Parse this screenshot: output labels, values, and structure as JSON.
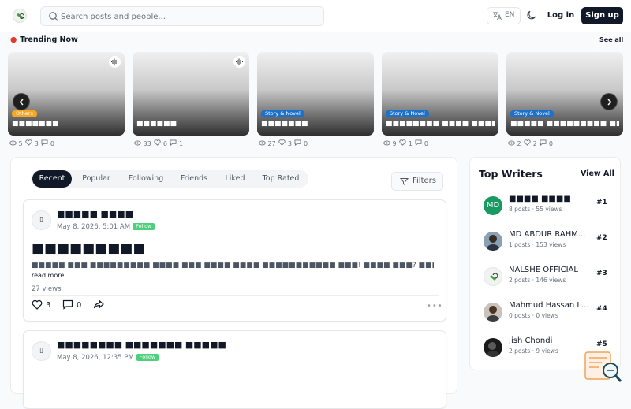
{
  "header": {
    "search_placeholder": "Search posts and people...",
    "lang_label": "EN",
    "login_label": "Log in",
    "signup_label": "Sign up"
  },
  "trending": {
    "title": "Trending Now",
    "see_all": "See all",
    "cards": [
      {
        "badge": "Others",
        "title": "■■■■■■■",
        "views": "5",
        "likes": "3",
        "comments": "0"
      },
      {
        "badge": "",
        "title": "■■■■■■",
        "views": "33",
        "likes": "6",
        "comments": "1"
      },
      {
        "badge": "Story & Novel",
        "title": "■■■■■■■",
        "views": "27",
        "likes": "3",
        "comments": "0"
      },
      {
        "badge": "Story & Novel",
        "title": "■■■■■■■■ ■■■■ ■■■■■■, ■…",
        "views": "9",
        "likes": "1",
        "comments": "0"
      },
      {
        "badge": "Story & Novel",
        "title": "■■■■■ ■■■■■■■■■ ■■■■■■",
        "views": "2",
        "likes": "2",
        "comments": "0"
      }
    ]
  },
  "feed": {
    "tabs": [
      "Recent",
      "Popular",
      "Following",
      "Friends",
      "Liked",
      "Top Rated"
    ],
    "filters_label": "Filters",
    "posts": [
      {
        "author": "■■■■■ ■■■■",
        "date": "May 8, 2026, 5:01 AM",
        "follow": "Follow",
        "title": "■■■■■■■■■",
        "excerpt": "■■■■■ ■■■ ■■■■■■■■■ ■■■■ ■■■ ■■■■ ■■■■ ■■■■■■■■■■■ ■■■! ■■■■ ■■■? ■■■■■■ ■■■■ ■■■■ ■■■ ■■■■ ■■■■■ ■■■■■ ■■",
        "read_more": "read more...",
        "views": "27 views",
        "likes": "3",
        "comments": "0"
      },
      {
        "author": "■■■■■■■■ ■■■■■■■ ■■■■■",
        "date": "May 8, 2026, 12:35 PM",
        "follow": "Follow"
      }
    ]
  },
  "writers": {
    "title": "Top Writers",
    "view_all": "View All",
    "list": [
      {
        "initials": "MD",
        "name": "■■■■ ■■■■",
        "meta": "8 posts · 55 views",
        "rank": "#1"
      },
      {
        "initials": "",
        "name": "MD ABDUR RAHM...",
        "meta": "1 posts · 153 views",
        "rank": "#2"
      },
      {
        "initials": "",
        "name": "NALSHE OFFICIAL",
        "meta": "2 posts · 146 views",
        "rank": "#3"
      },
      {
        "initials": "",
        "name": "Mahmud Hassan L...",
        "meta": "0 posts · 0 views",
        "rank": "#4"
      },
      {
        "initials": "",
        "name": "Jish Chondi",
        "meta": "2 posts · 9 views",
        "rank": "#5"
      }
    ]
  },
  "colors": {
    "primary": "#111827",
    "follow_green": "#4cd07a",
    "badge_orange": "#f5a623",
    "badge_blue": "#1d71c9",
    "writer1_avatar": "#1a9a63"
  }
}
